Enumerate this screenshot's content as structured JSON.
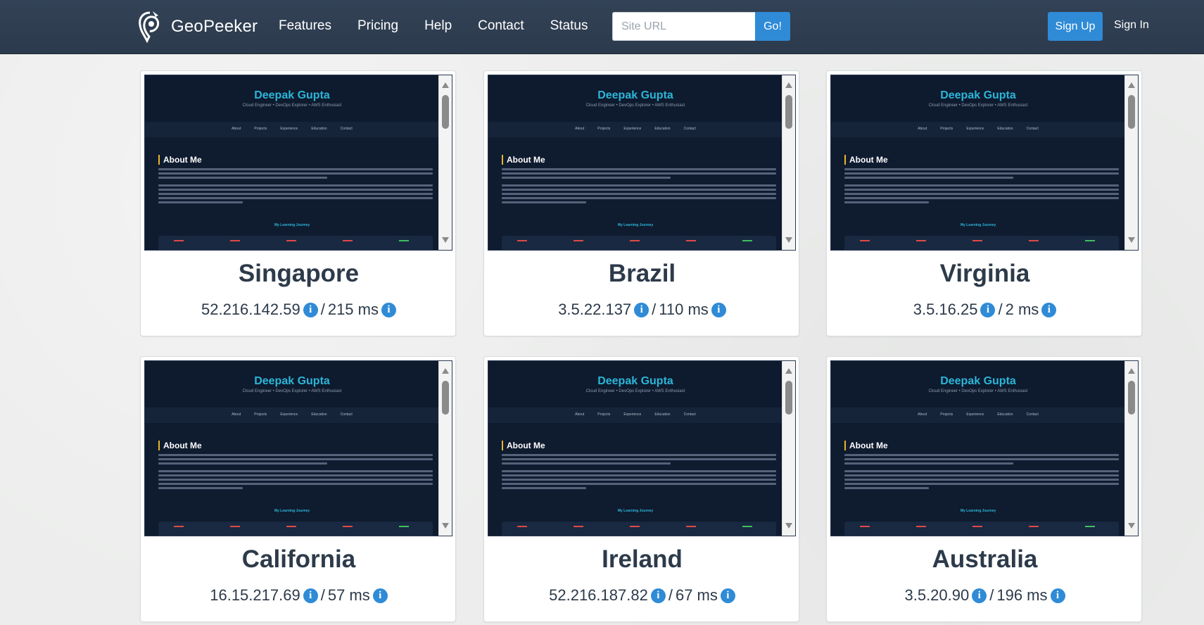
{
  "brand": {
    "name": "GeoPeeker"
  },
  "nav": [
    "Features",
    "Pricing",
    "Help",
    "Contact",
    "Status"
  ],
  "search": {
    "placeholder": "Site URL",
    "value": "",
    "button": "Go!"
  },
  "auth": {
    "signup": "Sign Up",
    "signin": "Sign In"
  },
  "preview": {
    "title": "Deepak Gupta",
    "subtitle": "Cloud Engineer • DevOps Explorer • AWS Enthusiast",
    "nav": [
      "About",
      "Projects",
      "Experience",
      "Education",
      "Contact"
    ],
    "heading": "About Me",
    "journey": "My Learning Journey"
  },
  "locations": [
    {
      "city": "Singapore",
      "ip": "52.216.142.59",
      "latency": "215 ms"
    },
    {
      "city": "Brazil",
      "ip": "3.5.22.137",
      "latency": "110 ms"
    },
    {
      "city": "Virginia",
      "ip": "3.5.16.25",
      "latency": "2 ms"
    },
    {
      "city": "California",
      "ip": "16.15.217.69",
      "latency": "57 ms"
    },
    {
      "city": "Ireland",
      "ip": "52.216.187.82",
      "latency": "67 ms"
    },
    {
      "city": "Australia",
      "ip": "3.5.20.90",
      "latency": "196 ms"
    }
  ],
  "colors": {
    "navbar": "#2f3d50",
    "accent": "#2f8bd6",
    "text": "#2d3a4a"
  },
  "icons": {
    "info": "info-circle-icon",
    "logo": "geopeeker-logo-icon"
  }
}
